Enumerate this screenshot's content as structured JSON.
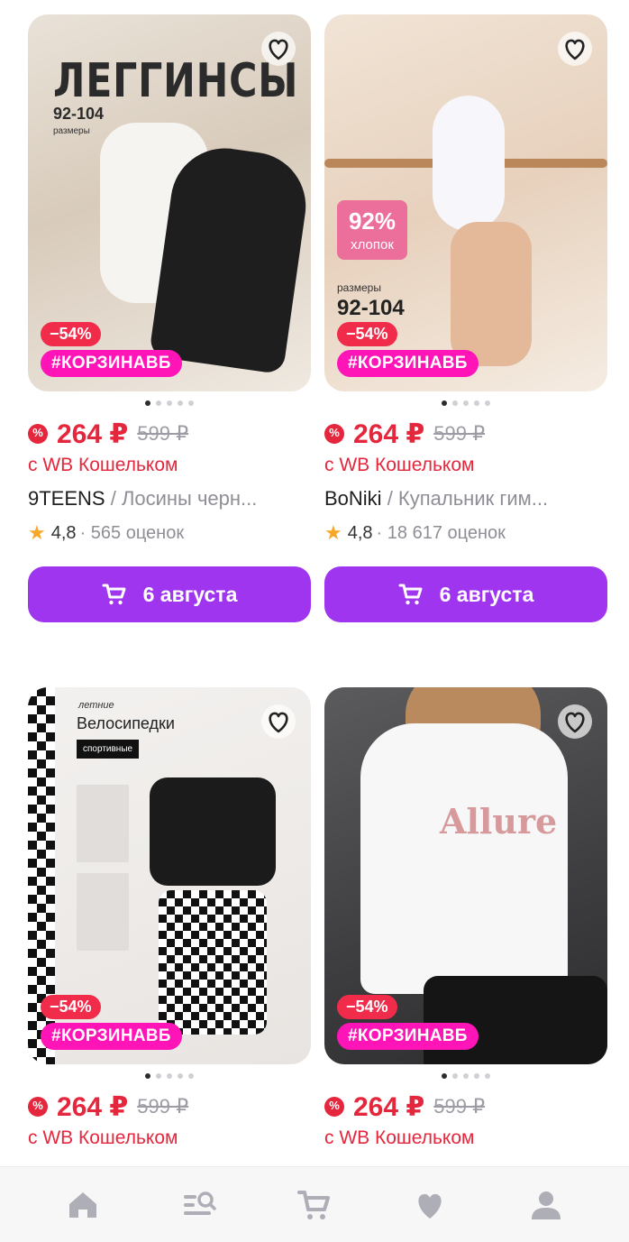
{
  "colors": {
    "price": "#e5273d",
    "discount_badge": "#f12c4b",
    "promo_badge": "#ff14b8",
    "cart_button": "#a035f0",
    "star": "#f7a728"
  },
  "products": [
    {
      "image_texts": {
        "title": "ЛЕГГИНСЫ",
        "sizes": "92-104",
        "sizes_label": "размеры"
      },
      "discount": "−54%",
      "promo": "#КОРЗИНАВБ",
      "price": "264 ₽",
      "old_price": "599 ₽",
      "wallet_text": "с WB Кошельком",
      "brand": "9TEENS",
      "title": "Лосины черн...",
      "rating": "4,8",
      "reviews": "565 оценок",
      "delivery": "6 августа"
    },
    {
      "image_texts": {
        "percent": "92%",
        "material": "хлопок",
        "sizes_label": "размеры",
        "sizes": "92-104"
      },
      "discount": "−54%",
      "promo": "#КОРЗИНАВБ",
      "price": "264 ₽",
      "old_price": "599 ₽",
      "wallet_text": "с WB Кошельком",
      "brand": "BoNiki",
      "title": "Купальник гим...",
      "rating": "4,8",
      "reviews": "18 617 оценок",
      "delivery": "6 августа"
    },
    {
      "image_texts": {
        "summer": "летние",
        "title": "Велосипедки",
        "tag": "спортивные"
      },
      "discount": "−54%",
      "promo": "#КОРЗИНАВБ",
      "price": "264 ₽",
      "old_price": "599 ₽",
      "wallet_text": "с WB Кошельком"
    },
    {
      "image_texts": {
        "shirt_brand": "Allure"
      },
      "discount": "−54%",
      "promo": "#КОРЗИНАВБ",
      "price": "264 ₽",
      "old_price": "599 ₽",
      "wallet_text": "с WB Кошельком"
    }
  ],
  "separator": " / ",
  "nav": [
    "home-icon",
    "catalog-search-icon",
    "cart-icon",
    "favorites-icon",
    "profile-icon"
  ]
}
